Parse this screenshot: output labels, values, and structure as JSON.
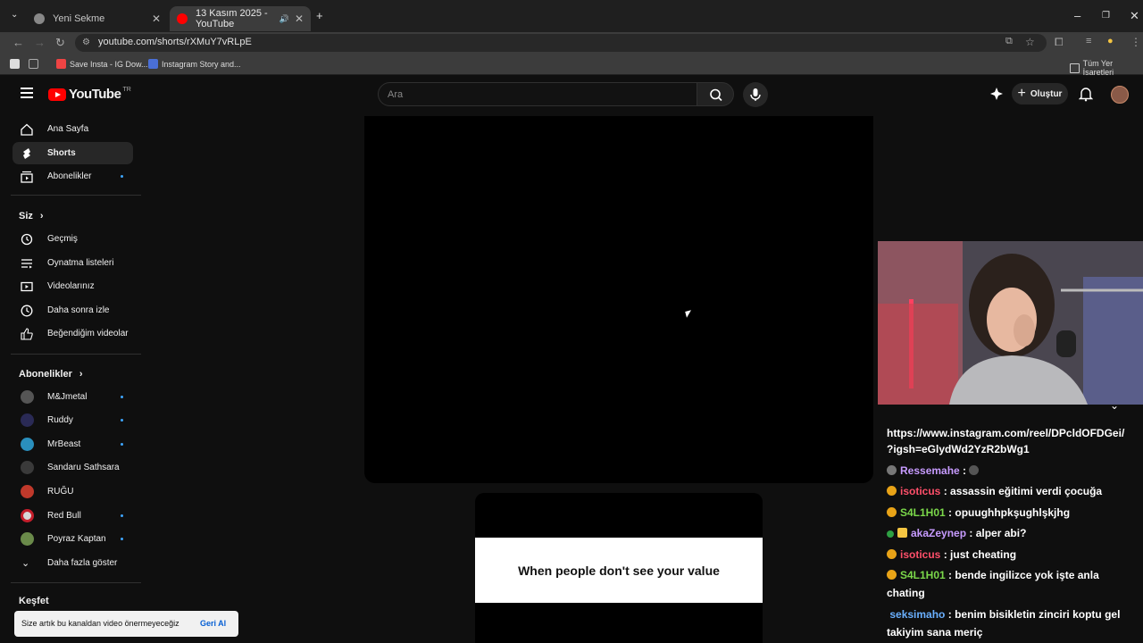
{
  "browser": {
    "tabs": [
      {
        "title": "Yeni Sekme"
      },
      {
        "title": "13 Kasım 2025 - YouTube"
      }
    ],
    "url": "youtube.com/shorts/rXMuY7vRLpE",
    "bookmarks": [
      {
        "label": "Save Insta - IG Dow..."
      },
      {
        "label": "Instagram Story and..."
      }
    ],
    "all_bookmarks": "Tüm Yer İşaretleri"
  },
  "youtube": {
    "logo_text": "YouTube",
    "region": "TR",
    "search_placeholder": "Ara",
    "create_label": "Oluştur"
  },
  "sidebar": {
    "main": [
      {
        "label": "Ana Sayfa"
      },
      {
        "label": "Shorts"
      },
      {
        "label": "Abonelikler"
      }
    ],
    "you_header": "Siz",
    "you": [
      {
        "label": "Geçmiş"
      },
      {
        "label": "Oynatma listeleri"
      },
      {
        "label": "Videolarınız"
      },
      {
        "label": "Daha sonra izle"
      },
      {
        "label": "Beğendiğim videolar"
      }
    ],
    "subs_header": "Abonelikler",
    "subs": [
      {
        "label": "M&Jmetal"
      },
      {
        "label": "Ruddy"
      },
      {
        "label": "MrBeast"
      },
      {
        "label": "Sandaru Sathsara"
      },
      {
        "label": "RUĞU"
      },
      {
        "label": "Red Bull"
      },
      {
        "label": "Poyraz Kaptan"
      }
    ],
    "show_more": "Daha fazla göster",
    "explore_header": "Keşfet"
  },
  "short_caption": "When people don't see your value",
  "chat": [
    {
      "user": "",
      "text": "https://www.instagram.com/reel/DPcldOFDGei/",
      "color": "#ffffff"
    },
    {
      "user": "",
      "text": "?igsh=eGlydWd2YzR2bWg1",
      "color": "#ffffff"
    },
    {
      "user": "Ressemahe",
      "text": "",
      "color": "#c79bff"
    },
    {
      "user": "isoticus",
      "text": "assassin eğitimi verdi çocuğa",
      "color": "#ff4f6a"
    },
    {
      "user": "S4L1H01",
      "text": "opuughhpkşughlşkjhg",
      "color": "#7bd84a"
    },
    {
      "user": "akaZeynep",
      "text": "alper abi?",
      "color": "#c79bff"
    },
    {
      "user": "isoticus",
      "text": "just cheating",
      "color": "#ff4f6a"
    },
    {
      "user": "S4L1H01",
      "text": "bende ingilizce yok işte anla",
      "color": "#7bd84a"
    },
    {
      "user": "",
      "text": "chating",
      "color": "#ffffff"
    },
    {
      "user": "seksimaho",
      "text": "benim bisikletin zinciri koptu gel",
      "color": "#6ab0ff"
    },
    {
      "user": "",
      "text": "takiyim sana meriç",
      "color": "#ffffff"
    }
  ],
  "toast": {
    "text": "Size artık bu kanaldan video önermeyeceğiz",
    "undo": "Geri Al"
  }
}
